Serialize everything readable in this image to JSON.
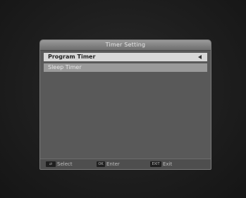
{
  "window": {
    "title": "Timer Setting"
  },
  "menu": {
    "items": [
      {
        "label": "Program Timer",
        "selected": true
      },
      {
        "label": "Sleep Timer",
        "selected": false
      }
    ]
  },
  "footer": {
    "hints": [
      {
        "key": "⇄",
        "label": "Select"
      },
      {
        "key": "OK",
        "label": "Enter"
      },
      {
        "key": "EXIT",
        "label": "Exit"
      }
    ]
  },
  "icons": {
    "selected_indicator": "left-arrow-icon"
  },
  "colors": {
    "panel": "#595959",
    "title_bar": "#8a8a8a",
    "selected_item": "#d8d8d8",
    "normal_item": "#9a9a9a"
  }
}
